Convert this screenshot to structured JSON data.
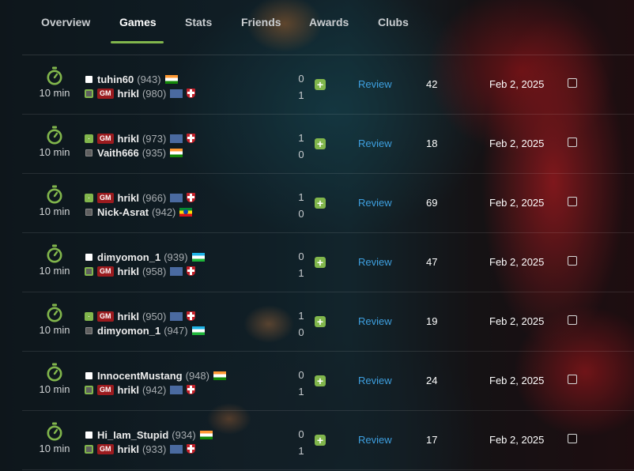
{
  "nav": {
    "tabs": [
      {
        "label": "Overview",
        "active": false
      },
      {
        "label": "Games",
        "active": true
      },
      {
        "label": "Stats",
        "active": false
      },
      {
        "label": "Friends",
        "active": false
      },
      {
        "label": "Awards",
        "active": false
      },
      {
        "label": "Clubs",
        "active": false
      }
    ]
  },
  "accent_color": "#81b64c",
  "link_color": "#3ea0e0",
  "games": [
    {
      "time_control": "10 min",
      "white": {
        "name": "tuhin60",
        "rating": "(943)",
        "title": "",
        "flag": "india"
      },
      "black": {
        "name": "hrikl",
        "rating": "(980)",
        "title": "GM",
        "flag": "club"
      },
      "white_score": "0",
      "black_score": "1",
      "winner": "black",
      "review_label": "Review",
      "moves": "42",
      "date": "Feb 2, 2025"
    },
    {
      "time_control": "10 min",
      "white": {
        "name": "hrikl",
        "rating": "(973)",
        "title": "GM",
        "flag": "club"
      },
      "black": {
        "name": "Vaith666",
        "rating": "(935)",
        "title": "",
        "flag": "india"
      },
      "white_score": "1",
      "black_score": "0",
      "winner": "white",
      "review_label": "Review",
      "moves": "18",
      "date": "Feb 2, 2025"
    },
    {
      "time_control": "10 min",
      "white": {
        "name": "hrikl",
        "rating": "(966)",
        "title": "GM",
        "flag": "club"
      },
      "black": {
        "name": "Nick-Asrat",
        "rating": "(942)",
        "title": "",
        "flag": "ethiopia"
      },
      "white_score": "1",
      "black_score": "0",
      "winner": "white",
      "review_label": "Review",
      "moves": "69",
      "date": "Feb 2, 2025"
    },
    {
      "time_control": "10 min",
      "white": {
        "name": "dimyomon_1",
        "rating": "(939)",
        "title": "",
        "flag": "uzbekistan"
      },
      "black": {
        "name": "hrikl",
        "rating": "(958)",
        "title": "GM",
        "flag": "club"
      },
      "white_score": "0",
      "black_score": "1",
      "winner": "black",
      "review_label": "Review",
      "moves": "47",
      "date": "Feb 2, 2025"
    },
    {
      "time_control": "10 min",
      "white": {
        "name": "hrikl",
        "rating": "(950)",
        "title": "GM",
        "flag": "club"
      },
      "black": {
        "name": "dimyomon_1",
        "rating": "(947)",
        "title": "",
        "flag": "uzbekistan"
      },
      "white_score": "1",
      "black_score": "0",
      "winner": "white",
      "review_label": "Review",
      "moves": "19",
      "date": "Feb 2, 2025"
    },
    {
      "time_control": "10 min",
      "white": {
        "name": "InnocentMustang",
        "rating": "(948)",
        "title": "",
        "flag": "india"
      },
      "black": {
        "name": "hrikl",
        "rating": "(942)",
        "title": "GM",
        "flag": "club"
      },
      "white_score": "0",
      "black_score": "1",
      "winner": "black",
      "review_label": "Review",
      "moves": "24",
      "date": "Feb 2, 2025"
    },
    {
      "time_control": "10 min",
      "white": {
        "name": "Hi_Iam_Stupid",
        "rating": "(934)",
        "title": "",
        "flag": "india"
      },
      "black": {
        "name": "hrikl",
        "rating": "(933)",
        "title": "GM",
        "flag": "club"
      },
      "white_score": "0",
      "black_score": "1",
      "winner": "black",
      "review_label": "Review",
      "moves": "17",
      "date": "Feb 2, 2025"
    }
  ]
}
